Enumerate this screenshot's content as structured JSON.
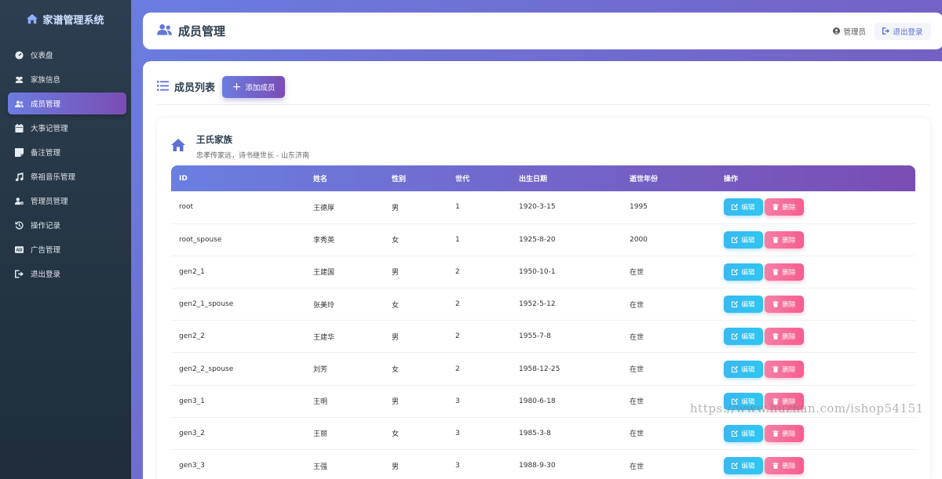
{
  "app": {
    "brand": "家谱管理系统"
  },
  "sidebar": {
    "items": [
      {
        "label": "仪表盘",
        "icon": "dashboard-icon",
        "active": false
      },
      {
        "label": "家族信息",
        "icon": "users-icon",
        "active": false
      },
      {
        "label": "成员管理",
        "icon": "user-group-icon",
        "active": true
      },
      {
        "label": "大事记管理",
        "icon": "calendar-icon",
        "active": false
      },
      {
        "label": "备注管理",
        "icon": "note-icon",
        "active": false
      },
      {
        "label": "祭祖音乐管理",
        "icon": "music-icon",
        "active": false
      },
      {
        "label": "管理员管理",
        "icon": "user-cog-icon",
        "active": false
      },
      {
        "label": "操作记录",
        "icon": "history-icon",
        "active": false
      },
      {
        "label": "广告管理",
        "icon": "ad-icon",
        "active": false
      },
      {
        "label": "退出登录",
        "icon": "logout-icon",
        "active": false
      }
    ]
  },
  "header": {
    "title": "成员管理",
    "user_label": "管理员",
    "logout_label": "退出登录"
  },
  "content": {
    "title": "成员列表",
    "add_label": "添加成员"
  },
  "family": {
    "name": "王氏家族",
    "description": "忠孝传家远，诗书继世长 - 山东济南"
  },
  "table": {
    "columns": [
      "ID",
      "姓名",
      "性别",
      "世代",
      "出生日期",
      "逝世年份",
      "操作"
    ],
    "edit_label": "编辑",
    "delete_label": "删除",
    "rows": [
      [
        "root",
        "王德厚",
        "男",
        "1",
        "1920-3-15",
        "1995"
      ],
      [
        "root_spouse",
        "李秀英",
        "女",
        "1",
        "1925-8-20",
        "2000"
      ],
      [
        "gen2_1",
        "王建国",
        "男",
        "2",
        "1950-10-1",
        "在世"
      ],
      [
        "gen2_1_spouse",
        "张美玲",
        "女",
        "2",
        "1952-5-12",
        "在世"
      ],
      [
        "gen2_2",
        "王建华",
        "男",
        "2",
        "1955-7-8",
        "在世"
      ],
      [
        "gen2_2_spouse",
        "刘芳",
        "女",
        "2",
        "1958-12-25",
        "在世"
      ],
      [
        "gen3_1",
        "王明",
        "男",
        "3",
        "1980-6-18",
        "在世"
      ],
      [
        "gen3_2",
        "王丽",
        "女",
        "3",
        "1985-3-8",
        "在世"
      ],
      [
        "gen3_3",
        "王强",
        "男",
        "3",
        "1988-9-30",
        "在世"
      ]
    ]
  },
  "watermark": "https://www.huzhan.com/ishop54151"
}
